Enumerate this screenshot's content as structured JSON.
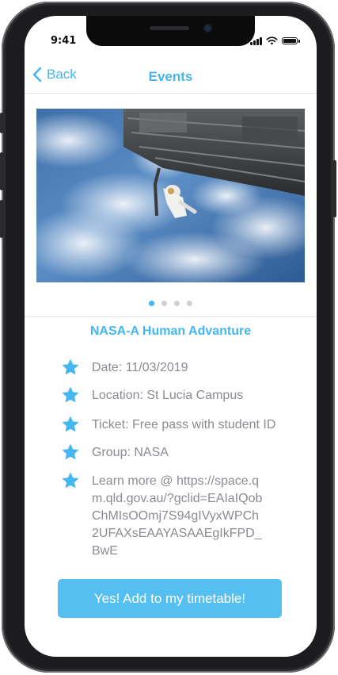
{
  "status_bar": {
    "time": "9:41"
  },
  "nav": {
    "back_label": "Back",
    "title": "Events"
  },
  "carousel": {
    "total": 4,
    "active_index": 0
  },
  "event": {
    "title": "NASA-A Human Advanture",
    "details": [
      {
        "icon": "star-icon",
        "text": "Date: 11/03/2019"
      },
      {
        "icon": "star-icon",
        "text": "Location: St Lucia Campus"
      },
      {
        "icon": "star-icon",
        "text": "Ticket: Free pass with student ID"
      },
      {
        "icon": "star-icon",
        "text": "Group: NASA"
      },
      {
        "icon": "star-icon",
        "text": "Learn more @ https://space.qm.qld.gov.au/?gclid=EAIaIQobChMIsOOmj7S94gIVyxWPCh2UFAXsEAAYASAAEgIkFPD_BwE"
      }
    ]
  },
  "cta": {
    "label": "Yes! Add to my timetable!"
  },
  "colors": {
    "accent": "#45b6f0",
    "button": "#56bff2",
    "detail_text": "#8b8b92"
  }
}
